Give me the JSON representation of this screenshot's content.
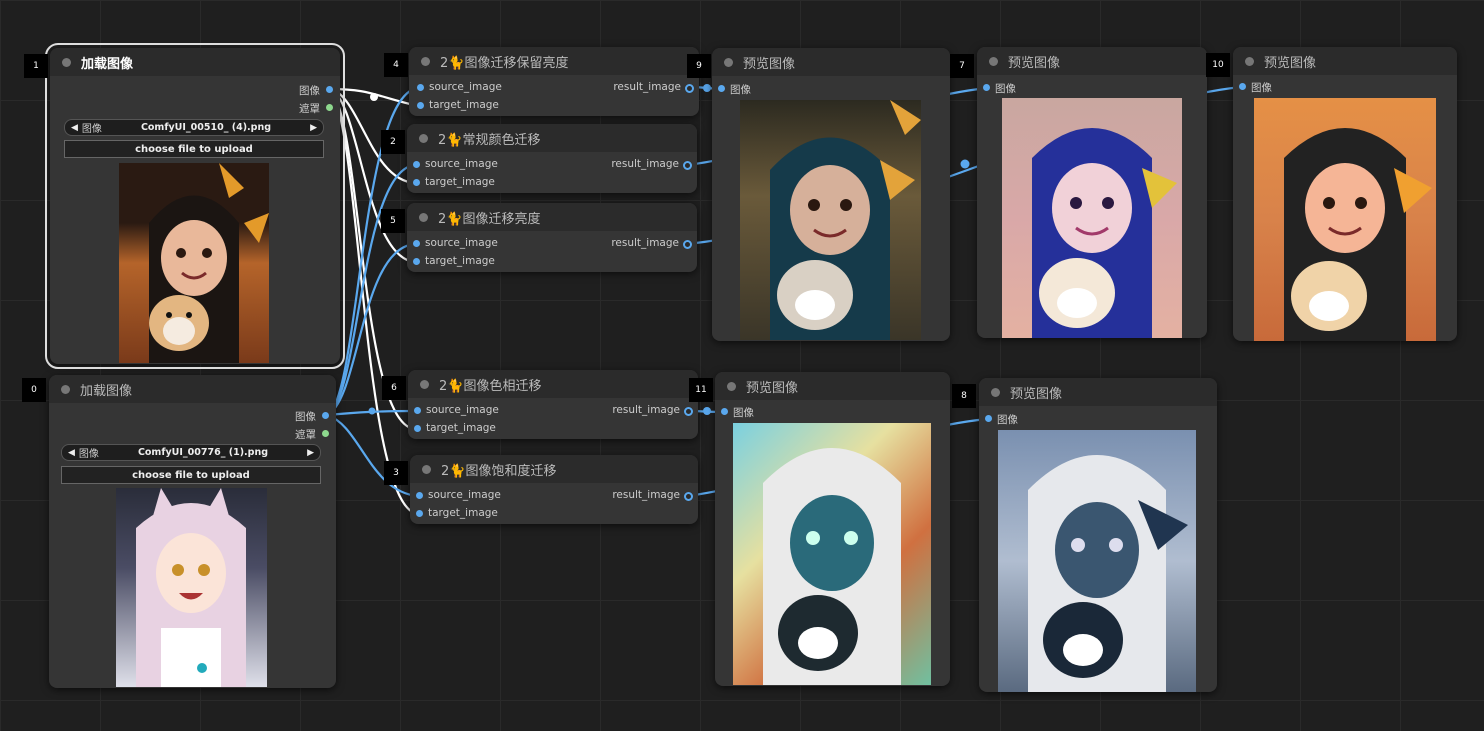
{
  "slots": {
    "source": "source_image",
    "target": "target_image",
    "result": "result_image",
    "image": "图像",
    "mask": "遮罩"
  },
  "load_nodes": [
    {
      "id": "1",
      "title": "加载图像",
      "combo_label": "图像",
      "filename": "ComfyUI_00510_ (4).png",
      "upload": "choose file to upload"
    },
    {
      "id": "0",
      "title": "加载图像",
      "combo_label": "图像",
      "filename": "ComfyUI_00776_ (1).png",
      "upload": "choose file to upload"
    }
  ],
  "transfer_nodes": [
    {
      "id": "4",
      "title": "2🐈图像迁移保留亮度"
    },
    {
      "id": "2",
      "title": "2🐈常规颜色迁移"
    },
    {
      "id": "5",
      "title": "2🐈图像迁移亮度"
    },
    {
      "id": "6",
      "title": "2🐈图像色相迁移"
    },
    {
      "id": "3",
      "title": "2🐈图像饱和度迁移"
    }
  ],
  "preview_nodes": [
    {
      "id": "9",
      "title": "预览图像"
    },
    {
      "id": "7",
      "title": "预览图像"
    },
    {
      "id": "10",
      "title": "预览图像"
    },
    {
      "id": "11",
      "title": "预览图像"
    },
    {
      "id": "8",
      "title": "预览图像"
    }
  ],
  "colors": {
    "link_image": "#5aa8ee",
    "link_mask": "#8ed98e",
    "link_selected": "#ffffff",
    "node_bg": "#353535",
    "title_bg": "#2b2b2b"
  }
}
